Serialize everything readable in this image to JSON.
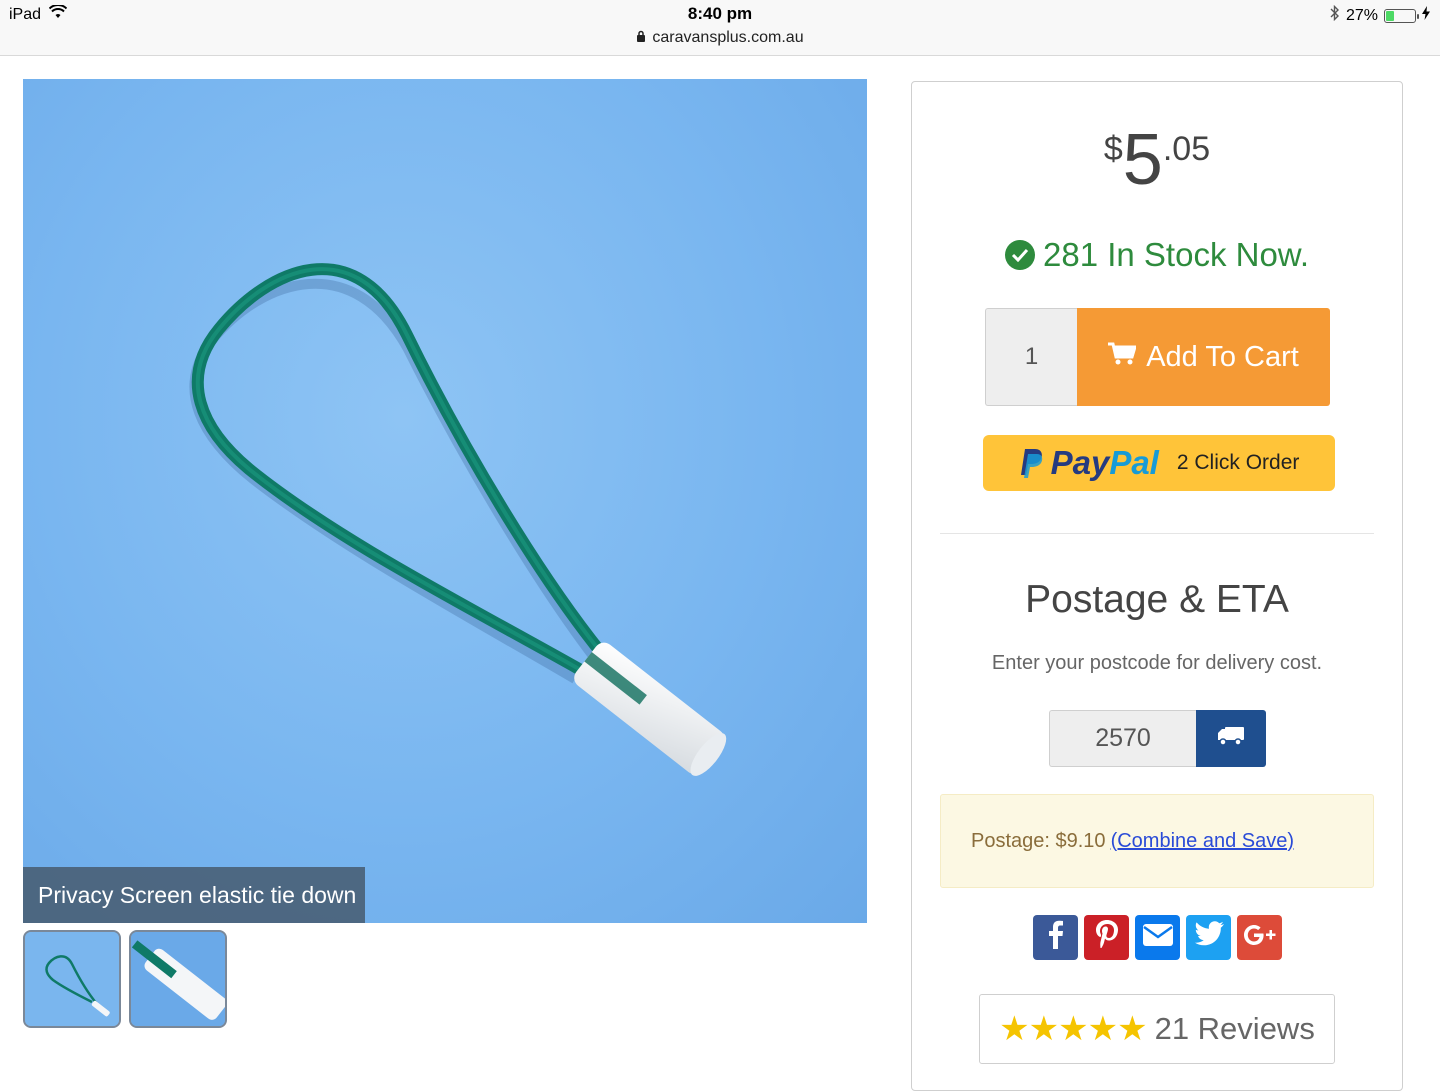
{
  "status_bar": {
    "device": "iPad",
    "time": "8:40 pm",
    "url": "caravansplus.com.au",
    "battery": "27%",
    "battery_level": 0.27
  },
  "product": {
    "caption": "Privacy Screen elastic tie down",
    "thumbnails": [
      "thumb-loop",
      "thumb-closeup"
    ]
  },
  "price": {
    "currency": "$",
    "dollars": "5",
    "cents": ".05"
  },
  "stock": {
    "text": "281 In Stock Now."
  },
  "cart": {
    "quantity": "1",
    "add_label": "Add To Cart"
  },
  "paypal": {
    "pay": "Pay",
    "pal": "Pal",
    "label": "2 Click Order"
  },
  "postage": {
    "title": "Postage & ETA",
    "subtitle": "Enter your postcode for delivery cost.",
    "postcode": "2570",
    "result_label": "Postage: $9.10",
    "combine_link": "(Combine and Save)"
  },
  "social": [
    "facebook-icon",
    "pinterest-icon",
    "email-icon",
    "twitter-icon",
    "google-plus-icon"
  ],
  "reviews": {
    "stars": "★★★★★",
    "rating": 5,
    "label": "21 Reviews"
  },
  "colors": {
    "accent_orange": "#f59a35",
    "stock_green": "#2e8b3d",
    "paypal_yellow": "#ffc439",
    "truck_blue": "#1f4f8f"
  }
}
